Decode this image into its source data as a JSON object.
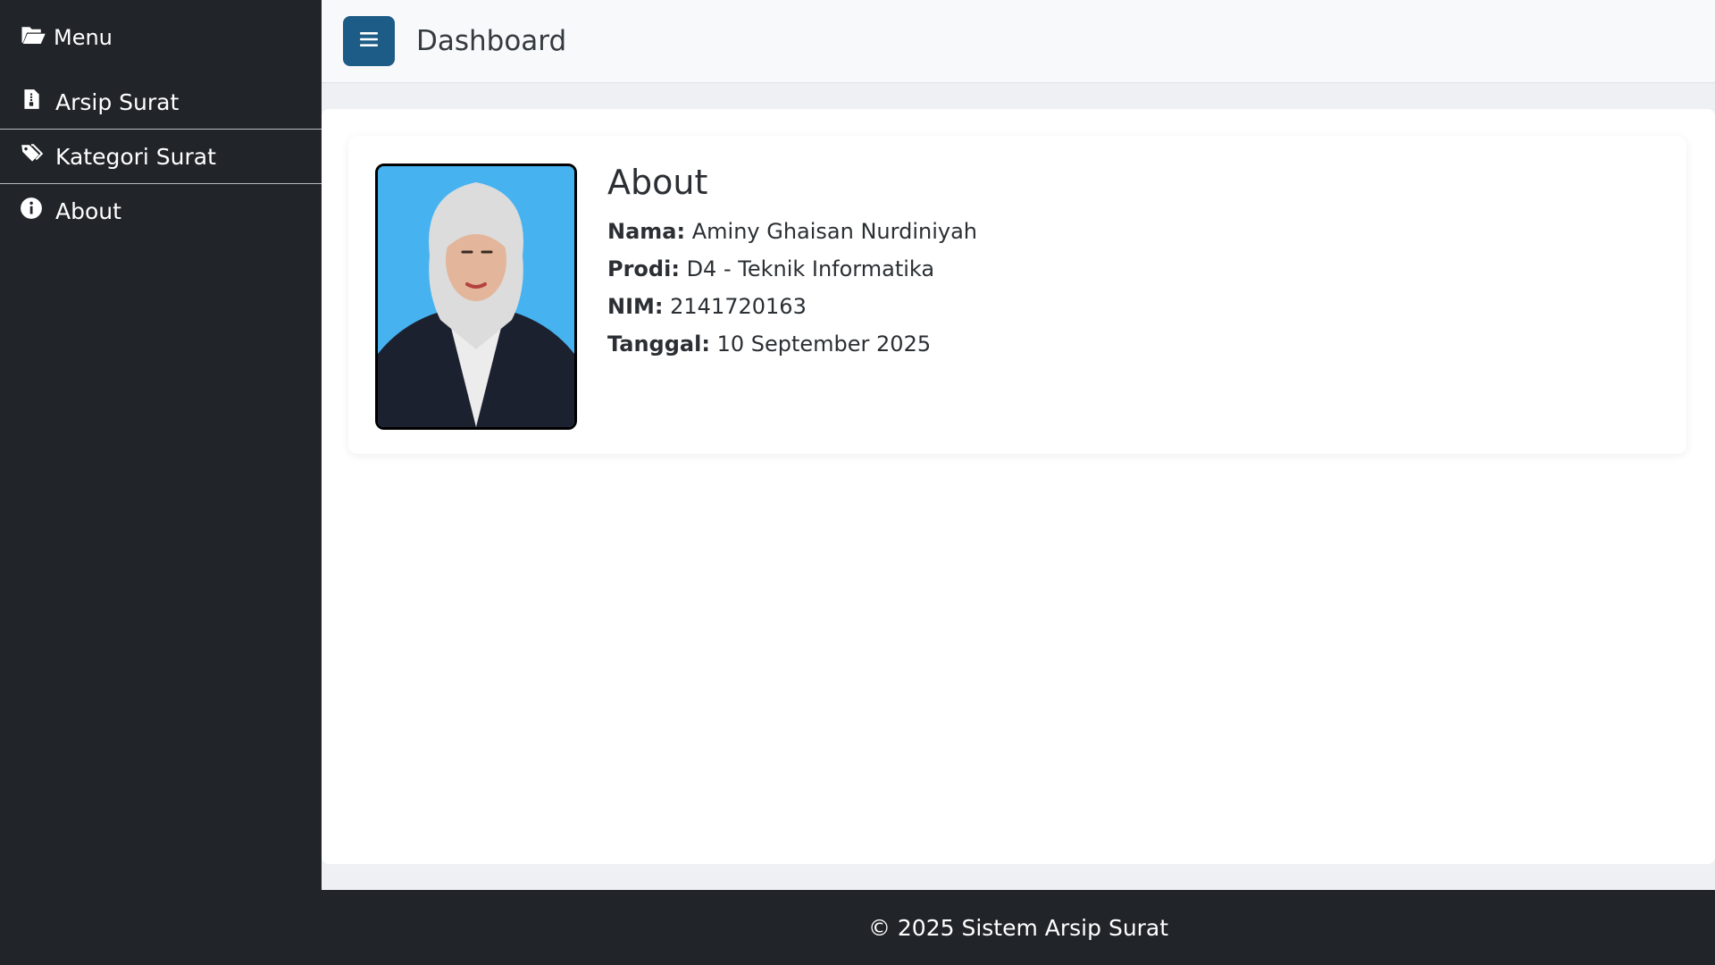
{
  "sidebar": {
    "brand": {
      "label": "Menu",
      "icon": "folder-open-icon"
    },
    "items": [
      {
        "label": "Arsip Surat",
        "icon": "file-icon"
      },
      {
        "label": "Kategori Surat",
        "icon": "tags-icon"
      },
      {
        "label": "About",
        "icon": "info-circle-icon"
      }
    ]
  },
  "header": {
    "toggle_icon": "hamburger-menu-icon",
    "title": "Dashboard"
  },
  "about": {
    "heading": "About",
    "fields": [
      {
        "label": "Nama:",
        "value": "Aminy Ghaisan Nurdiniyah"
      },
      {
        "label": "Prodi:",
        "value": "D4 - Teknik Informatika"
      },
      {
        "label": "NIM:",
        "value": "2141720163"
      },
      {
        "label": "Tanggal:",
        "value": "10 September 2025"
      }
    ]
  },
  "footer": {
    "text": "© 2025 Sistem Arsip Surat"
  },
  "colors": {
    "sidebar_bg": "#212529",
    "accent_button": "#1d5c86",
    "photo_background": "#46b3f0"
  }
}
